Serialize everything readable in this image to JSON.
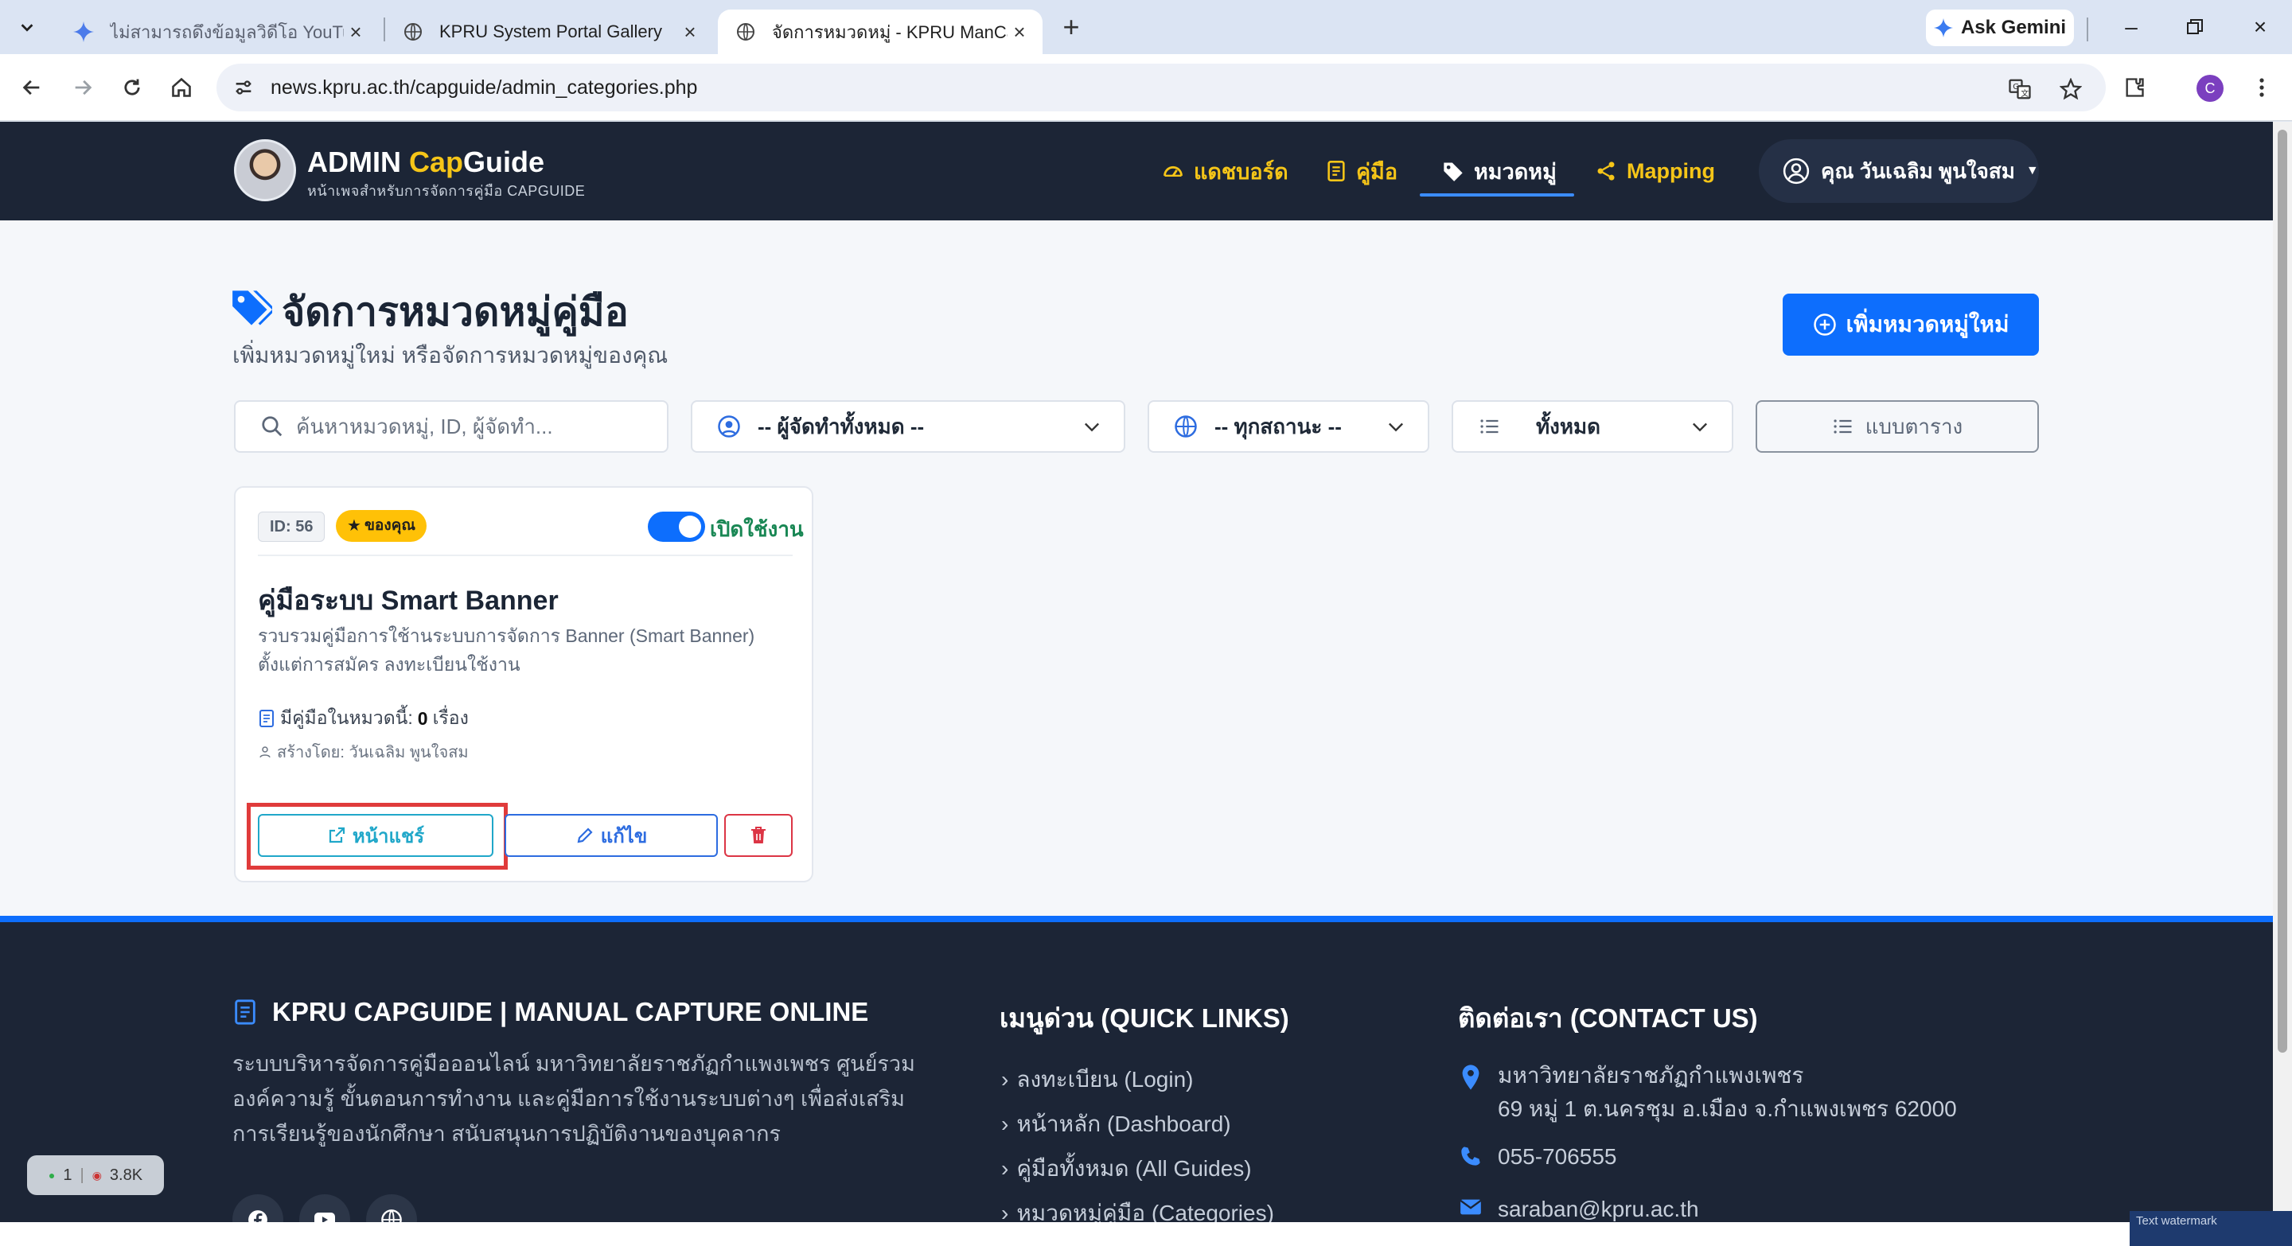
{
  "browser": {
    "tabs": [
      {
        "title": "ไม่สามารถดึงข้อมูลวิดีโอ YouTube - ",
        "active": false
      },
      {
        "title": "KPRU System Portal Gallery",
        "active": false
      },
      {
        "title": "จัดการหมวดหมู่ - KPRU ManCap",
        "active": true
      }
    ],
    "gemini_label": "Ask Gemini",
    "url": "news.kpru.ac.th/capguide/admin_categories.php",
    "profile_initial": "C"
  },
  "header": {
    "brand_part1": "ADMIN ",
    "brand_part2": "Cap",
    "brand_part3": "Guide",
    "subtitle": "หน้าเพจสำหรับการจัดการคู่มือ CAPGUIDE",
    "nav": [
      {
        "label": "แดชบอร์ด",
        "icon": "dashboard-icon"
      },
      {
        "label": "คู่มือ",
        "icon": "manual-icon"
      },
      {
        "label": "หมวดหมู่",
        "icon": "tag-icon",
        "active": true
      },
      {
        "label": "Mapping",
        "icon": "share-icon"
      }
    ],
    "user": "คุณ วันเฉลิม พูนใจสม"
  },
  "page": {
    "title": "จัดการหมวดหมู่คู่มือ",
    "subtitle": "เพิ่มหมวดหมู่ใหม่ หรือจัดการหมวดหมู่ของคุณ",
    "add_button": "เพิ่มหมวดหมู่ใหม่"
  },
  "filters": {
    "search_placeholder": "ค้นหาหมวดหมู่, ID, ผู้จัดทำ...",
    "owner": "-- ผู้จัดทำทั้งหมด --",
    "status": "-- ทุกสถานะ --",
    "count": "ทั้งหมด",
    "view": "แบบตาราง"
  },
  "card": {
    "id": "ID: 56",
    "own_badge": "ของคุณ",
    "toggle_label": "เปิดใช้งาน",
    "title": "คู่มือระบบ Smart Banner",
    "desc": "รวบรวมคู่มือการใช้านระบบการจัดการ Banner (Smart Banner) ตั้งแต่การสมัคร ลงทะเบียนใช้งาน",
    "count_label": "มีคู่มือในหมวดนี้:",
    "count_value": "0",
    "count_unit": "เรื่อง",
    "created_by": "สร้างโดย: วันเฉลิม พูนใจสม",
    "share_button": "หน้าแชร์",
    "edit_button": "แก้ไข"
  },
  "footer": {
    "about_title": "KPRU CAPGUIDE | MANUAL CAPTURE ONLINE",
    "about_desc": "ระบบบริหารจัดการคู่มือออนไลน์ มหาวิทยาลัยราชภัฏกำแพงเพชร ศูนย์รวมองค์ความรู้ ขั้นตอนการทำงาน และคู่มือการใช้งานระบบต่างๆ เพื่อส่งเสริมการเรียนรู้ของนักศึกษา สนับสนุนการปฏิบัติงานของบุคลากร",
    "links_title": "เมนูด่วน (QUICK LINKS)",
    "links": [
      "ลงทะเบียน (Login)",
      "หน้าหลัก (Dashboard)",
      "คู่มือทั้งหมด (All Guides)",
      "หมวดหมู่คู่มือ (Categories)"
    ],
    "contact_title": "ติดต่อเรา (CONTACT US)",
    "address_line1": "มหาวิทยาลัยราชภัฏกำแพงเพชร",
    "address_line2": "69 หมู่ 1 ต.นครชุม อ.เมือง จ.กำแพงเพชร 62000",
    "phone": "055-706555",
    "email": "saraban@kpru.ac.th"
  },
  "misc": {
    "online_count": "1",
    "views_count": "3.8K",
    "watermark": "Text watermark"
  },
  "colors": {
    "header_bg": "#1c2536",
    "accent_yellow": "#f5c518",
    "primary_blue": "#0d6efd",
    "success_green": "#198754",
    "danger_red": "#dc3545",
    "info_cyan": "#20a7c9",
    "highlight_red": "#e03b3b"
  }
}
